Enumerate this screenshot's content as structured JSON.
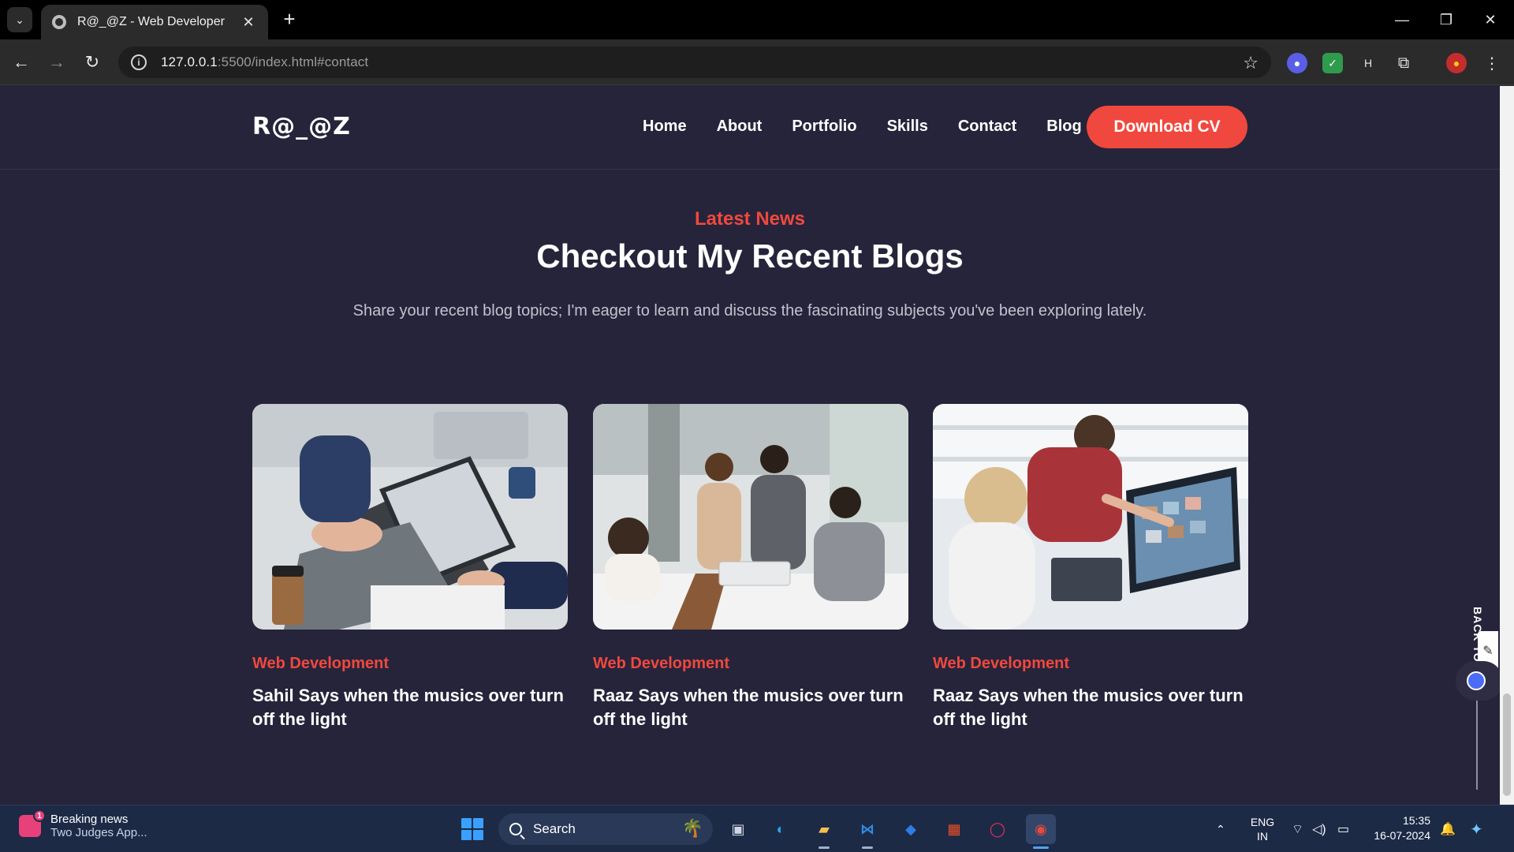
{
  "browser": {
    "tab_title": "R@_@Z - Web Developer",
    "url_host": "127.0.0.1",
    "url_rest": ":5500/index.html#contact"
  },
  "site": {
    "logo": "R@_@Z",
    "nav": [
      "Home",
      "About",
      "Portfolio",
      "Skills",
      "Contact",
      "Blog"
    ],
    "cta": "Download CV"
  },
  "section": {
    "tag": "Latest News",
    "title": "Checkout My Recent Blogs",
    "description": "Share your recent blog topics; I'm eager to learn and discuss the fascinating subjects you've been exploring lately."
  },
  "blogs": [
    {
      "category": "Web Development",
      "title": "Sahil Says when the musics over turn off the light"
    },
    {
      "category": "Web Development",
      "title": "Raaz Says when the musics over turn off the light"
    },
    {
      "category": "Web Development",
      "title": "Raaz Says when the musics over turn off the light"
    }
  ],
  "back_to_top": "BACK TO",
  "taskbar": {
    "news_title": "Breaking news",
    "news_sub": "Two Judges App...",
    "news_badge": "1",
    "search": "Search",
    "lang_1": "ENG",
    "lang_2": "IN",
    "time": "15:35",
    "date": "16-07-2024"
  },
  "colors": {
    "accent": "#f0483e",
    "page_bg": "#26243a"
  }
}
